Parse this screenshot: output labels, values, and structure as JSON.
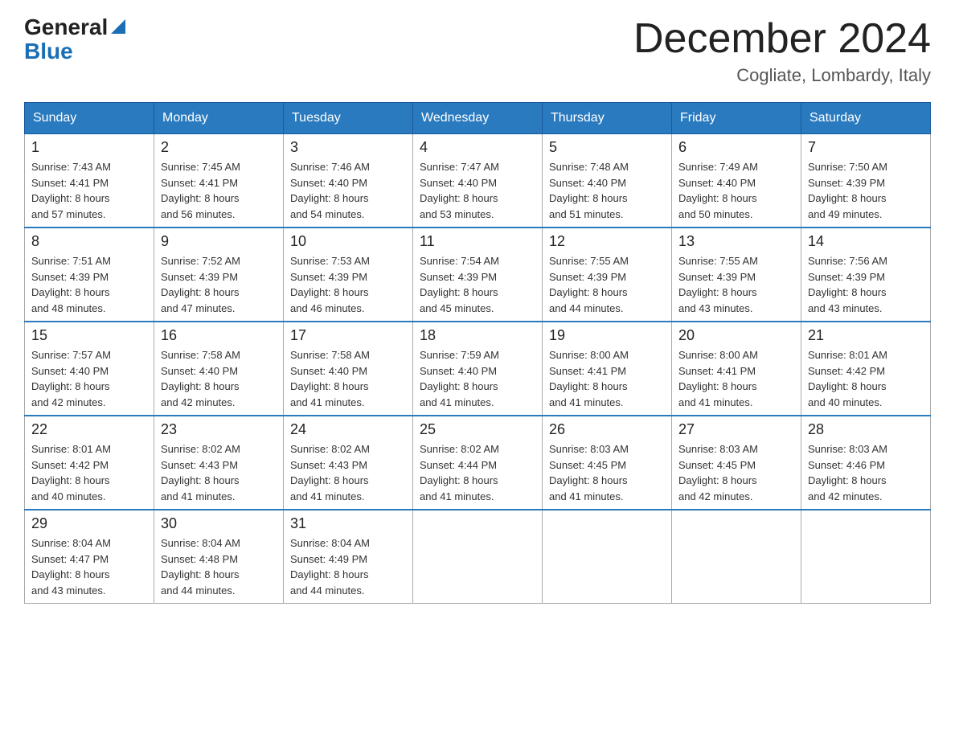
{
  "header": {
    "logo_general": "General",
    "logo_blue": "Blue",
    "month_title": "December 2024",
    "location": "Cogliate, Lombardy, Italy"
  },
  "days_of_week": [
    "Sunday",
    "Monday",
    "Tuesday",
    "Wednesday",
    "Thursday",
    "Friday",
    "Saturday"
  ],
  "weeks": [
    [
      {
        "day": "1",
        "sunrise": "7:43 AM",
        "sunset": "4:41 PM",
        "daylight": "8 hours and 57 minutes."
      },
      {
        "day": "2",
        "sunrise": "7:45 AM",
        "sunset": "4:41 PM",
        "daylight": "8 hours and 56 minutes."
      },
      {
        "day": "3",
        "sunrise": "7:46 AM",
        "sunset": "4:40 PM",
        "daylight": "8 hours and 54 minutes."
      },
      {
        "day": "4",
        "sunrise": "7:47 AM",
        "sunset": "4:40 PM",
        "daylight": "8 hours and 53 minutes."
      },
      {
        "day": "5",
        "sunrise": "7:48 AM",
        "sunset": "4:40 PM",
        "daylight": "8 hours and 51 minutes."
      },
      {
        "day": "6",
        "sunrise": "7:49 AM",
        "sunset": "4:40 PM",
        "daylight": "8 hours and 50 minutes."
      },
      {
        "day": "7",
        "sunrise": "7:50 AM",
        "sunset": "4:39 PM",
        "daylight": "8 hours and 49 minutes."
      }
    ],
    [
      {
        "day": "8",
        "sunrise": "7:51 AM",
        "sunset": "4:39 PM",
        "daylight": "8 hours and 48 minutes."
      },
      {
        "day": "9",
        "sunrise": "7:52 AM",
        "sunset": "4:39 PM",
        "daylight": "8 hours and 47 minutes."
      },
      {
        "day": "10",
        "sunrise": "7:53 AM",
        "sunset": "4:39 PM",
        "daylight": "8 hours and 46 minutes."
      },
      {
        "day": "11",
        "sunrise": "7:54 AM",
        "sunset": "4:39 PM",
        "daylight": "8 hours and 45 minutes."
      },
      {
        "day": "12",
        "sunrise": "7:55 AM",
        "sunset": "4:39 PM",
        "daylight": "8 hours and 44 minutes."
      },
      {
        "day": "13",
        "sunrise": "7:55 AM",
        "sunset": "4:39 PM",
        "daylight": "8 hours and 43 minutes."
      },
      {
        "day": "14",
        "sunrise": "7:56 AM",
        "sunset": "4:39 PM",
        "daylight": "8 hours and 43 minutes."
      }
    ],
    [
      {
        "day": "15",
        "sunrise": "7:57 AM",
        "sunset": "4:40 PM",
        "daylight": "8 hours and 42 minutes."
      },
      {
        "day": "16",
        "sunrise": "7:58 AM",
        "sunset": "4:40 PM",
        "daylight": "8 hours and 42 minutes."
      },
      {
        "day": "17",
        "sunrise": "7:58 AM",
        "sunset": "4:40 PM",
        "daylight": "8 hours and 41 minutes."
      },
      {
        "day": "18",
        "sunrise": "7:59 AM",
        "sunset": "4:40 PM",
        "daylight": "8 hours and 41 minutes."
      },
      {
        "day": "19",
        "sunrise": "8:00 AM",
        "sunset": "4:41 PM",
        "daylight": "8 hours and 41 minutes."
      },
      {
        "day": "20",
        "sunrise": "8:00 AM",
        "sunset": "4:41 PM",
        "daylight": "8 hours and 41 minutes."
      },
      {
        "day": "21",
        "sunrise": "8:01 AM",
        "sunset": "4:42 PM",
        "daylight": "8 hours and 40 minutes."
      }
    ],
    [
      {
        "day": "22",
        "sunrise": "8:01 AM",
        "sunset": "4:42 PM",
        "daylight": "8 hours and 40 minutes."
      },
      {
        "day": "23",
        "sunrise": "8:02 AM",
        "sunset": "4:43 PM",
        "daylight": "8 hours and 41 minutes."
      },
      {
        "day": "24",
        "sunrise": "8:02 AM",
        "sunset": "4:43 PM",
        "daylight": "8 hours and 41 minutes."
      },
      {
        "day": "25",
        "sunrise": "8:02 AM",
        "sunset": "4:44 PM",
        "daylight": "8 hours and 41 minutes."
      },
      {
        "day": "26",
        "sunrise": "8:03 AM",
        "sunset": "4:45 PM",
        "daylight": "8 hours and 41 minutes."
      },
      {
        "day": "27",
        "sunrise": "8:03 AM",
        "sunset": "4:45 PM",
        "daylight": "8 hours and 42 minutes."
      },
      {
        "day": "28",
        "sunrise": "8:03 AM",
        "sunset": "4:46 PM",
        "daylight": "8 hours and 42 minutes."
      }
    ],
    [
      {
        "day": "29",
        "sunrise": "8:04 AM",
        "sunset": "4:47 PM",
        "daylight": "8 hours and 43 minutes."
      },
      {
        "day": "30",
        "sunrise": "8:04 AM",
        "sunset": "4:48 PM",
        "daylight": "8 hours and 44 minutes."
      },
      {
        "day": "31",
        "sunrise": "8:04 AM",
        "sunset": "4:49 PM",
        "daylight": "8 hours and 44 minutes."
      },
      null,
      null,
      null,
      null
    ]
  ],
  "labels": {
    "sunrise": "Sunrise:",
    "sunset": "Sunset:",
    "daylight": "Daylight:"
  }
}
